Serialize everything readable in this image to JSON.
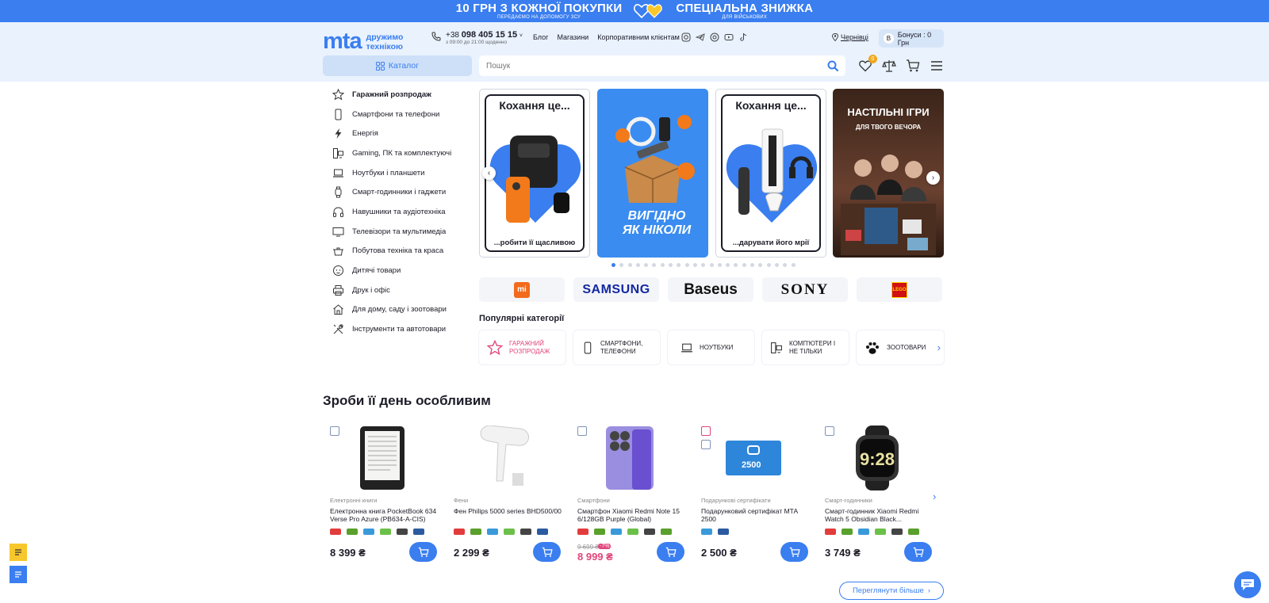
{
  "promo": {
    "left_big": "10 ГРН З КОЖНОЇ ПОКУПКИ",
    "left_small": "ПЕРЕДАЄМО НА ДОПОМОГУ ЗСУ",
    "right_big": "СПЕЦІАЛЬНА ЗНИЖКА",
    "right_small": "ДЛЯ ВІЙСЬКОВИХ"
  },
  "header": {
    "logo": "mta",
    "tagline_1": "дружимо",
    "tagline_2": "технікою",
    "phone_prefix": "+38",
    "phone": "098 405 15 15",
    "hours": "з 09:00 до 21:00 щоденно",
    "nav": [
      "Блог",
      "Магазини",
      "Корпоративним клієнтам"
    ],
    "city": "Чернівці",
    "bonus_letter": "B",
    "bonus": "Бонуси : 0 Грн",
    "catalog": "Каталог",
    "search_placeholder": "Пошук",
    "favorites_count": "0"
  },
  "sidebar": {
    "items": [
      {
        "label": "Гаражний розпродаж",
        "icon": "star-icon"
      },
      {
        "label": "Смартфони та телефони",
        "icon": "smartphone-icon"
      },
      {
        "label": "Енергія",
        "icon": "lightning-icon"
      },
      {
        "label": "Gaming, ПК та комплектуючі",
        "icon": "pc-icon"
      },
      {
        "label": "Ноутбуки і планшети",
        "icon": "laptop-icon"
      },
      {
        "label": "Смарт-годинники і гаджети",
        "icon": "watch-icon"
      },
      {
        "label": "Навушники та аудіотехніка",
        "icon": "headphones-icon"
      },
      {
        "label": "Телевізори та мультимедіа",
        "icon": "tv-icon"
      },
      {
        "label": "Побутова техніка та краса",
        "icon": "pot-icon"
      },
      {
        "label": "Дитячі товари",
        "icon": "baby-icon"
      },
      {
        "label": "Друк і офіс",
        "icon": "printer-icon"
      },
      {
        "label": "Для дому, саду і зоотовари",
        "icon": "house-icon"
      },
      {
        "label": "Інструменти та автотовари",
        "icon": "tools-icon"
      }
    ]
  },
  "banners": {
    "love_title": "Кохання це...",
    "love_bottom_1": "...робити її щасливою",
    "sale_line_1": "ВИГІДНО",
    "sale_line_2": "ЯК НІКОЛИ",
    "love_bottom_2": "...дарувати його мрії",
    "games_title": "НАСТІЛЬНІ ІГРИ",
    "games_sub": "ДЛЯ ТВОГО ВЕЧОРА"
  },
  "carousel": {
    "total": 23,
    "active": 0
  },
  "brands": [
    "mi",
    "SAMSUNG",
    "Baseus",
    "SONY",
    "LEGO"
  ],
  "popular": {
    "title": "Популярні категорії",
    "items": [
      {
        "label": "Гаражний розпродаж",
        "icon": "star-icon"
      },
      {
        "label": "Смартфони, телефони",
        "icon": "smartphone-icon"
      },
      {
        "label": "Ноутбуки",
        "icon": "laptop-icon"
      },
      {
        "label": "Комп'ютери і не тільки",
        "icon": "pc-icon"
      },
      {
        "label": "Зоотовари",
        "icon": "paw-icon"
      }
    ]
  },
  "products_section": {
    "title": "Зроби її день особливим",
    "more": "Переглянути більше",
    "items": [
      {
        "category": "Електронні книги",
        "name": "Електронна книга PocketBook 634 Verse Pro Azure (PB634-A-CIS)",
        "price": "8 399 ₴"
      },
      {
        "category": "Фени",
        "name": "Фен Philips 5000 series BHD500/00",
        "price": "2 299 ₴"
      },
      {
        "category": "Смартфони",
        "name": "Смартфон Xiaomi Redmi Note 15 6/128GB Purple (Global)",
        "old_price": "9 699 ₴",
        "discount": "-7%",
        "price": "8 999 ₴"
      },
      {
        "category": "Подарункові сертифікати",
        "name": "Подарунковий сертифікат МТА 2500",
        "price": "2 500 ₴",
        "card_text": "2500"
      },
      {
        "category": "Смарт-годинники",
        "name": "Смарт-годинник Xiaomi Redmi Watch 5 Obsidian Black...",
        "price": "3 749 ₴"
      }
    ]
  },
  "colors": {
    "accent": "#3a7ef0",
    "header_bg": "#e9f2fd",
    "sale": "#e0457b",
    "badge": "#f0a81c"
  }
}
